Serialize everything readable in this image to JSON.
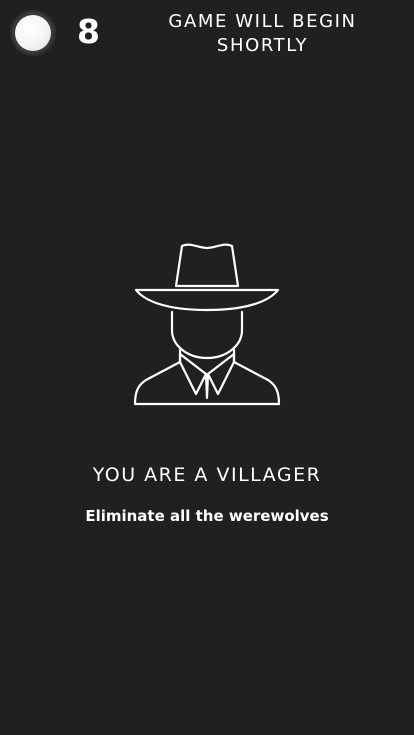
{
  "header": {
    "moon_icon": "full-moon-icon",
    "countdown": "8",
    "status_line1": "GAME WILL BEGIN",
    "status_line2": "SHORTLY"
  },
  "role_card": {
    "icon": "villager-hat-icon",
    "role_title": "YOU ARE A VILLAGER",
    "objective": "Eliminate all the werewolves"
  },
  "colors": {
    "background": "#202020",
    "text": "#ffffff"
  }
}
